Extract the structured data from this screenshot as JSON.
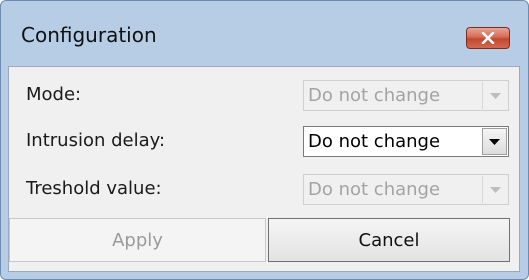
{
  "window": {
    "title": "Configuration"
  },
  "form": {
    "rows": [
      {
        "label": "Mode:",
        "value": "Do not change",
        "enabled": false
      },
      {
        "label": "Intrusion delay:",
        "value": "Do not change",
        "enabled": true
      },
      {
        "label": "Treshold value:",
        "value": "Do not change",
        "enabled": false
      }
    ]
  },
  "buttons": {
    "apply_label": "Apply",
    "apply_enabled": false,
    "cancel_label": "Cancel"
  },
  "icons": {
    "close": "close-icon",
    "dropdown": "chevron-down-icon"
  },
  "colors": {
    "title_bar": "#b7cde6",
    "close_button": "#c2482f",
    "disabled_text": "#a3a3a3"
  }
}
